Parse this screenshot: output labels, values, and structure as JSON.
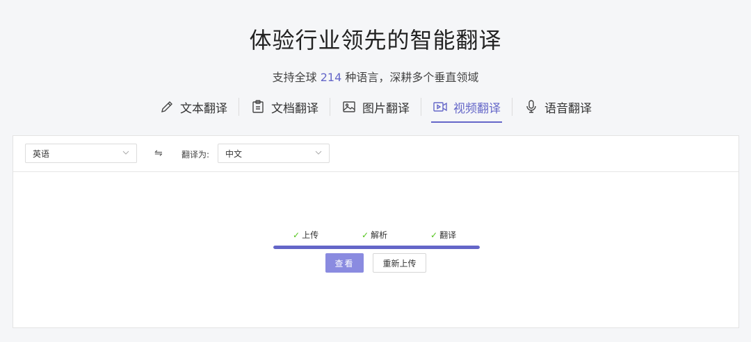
{
  "header": {
    "title": "体验行业领先的智能翻译",
    "subtitle_prefix": "支持全球",
    "subtitle_count": "214",
    "subtitle_suffix": "种语言，深耕多个垂直领域"
  },
  "tabs": [
    {
      "label": "文本翻译",
      "icon": "pencil-icon",
      "active": false
    },
    {
      "label": "文档翻译",
      "icon": "document-icon",
      "active": false
    },
    {
      "label": "图片翻译",
      "icon": "image-icon",
      "active": false
    },
    {
      "label": "视频翻译",
      "icon": "video-icon",
      "active": true
    },
    {
      "label": "语音翻译",
      "icon": "microphone-icon",
      "active": false
    }
  ],
  "toolbar": {
    "source_lang": "英语",
    "swap_symbol": "⇋",
    "target_label": "翻译为:",
    "target_lang": "中文"
  },
  "progress": {
    "steps": [
      {
        "label": "上传",
        "done": true
      },
      {
        "label": "解析",
        "done": true
      },
      {
        "label": "翻译",
        "done": true
      }
    ],
    "fraction": 1.0
  },
  "actions": {
    "view_label": "查看",
    "reupload_label": "重新上传"
  },
  "colors": {
    "accent": "#6466c8",
    "check": "#52c41a",
    "view_button": "#8a8be0"
  }
}
